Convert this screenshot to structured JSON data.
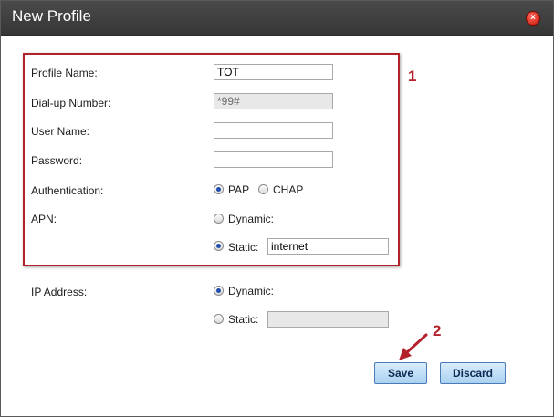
{
  "dialog": {
    "title": "New Profile",
    "close_icon": "close-icon",
    "close_glyph": "×"
  },
  "form": {
    "profile_name": {
      "label": "Profile Name:",
      "value": "TOT"
    },
    "dialup_number": {
      "label": "Dial-up Number:",
      "value": "*99#"
    },
    "user_name": {
      "label": "User Name:",
      "value": ""
    },
    "password": {
      "label": "Password:",
      "value": ""
    },
    "authentication": {
      "label": "Authentication:",
      "options": [
        {
          "label": "PAP",
          "checked": true
        },
        {
          "label": "CHAP",
          "checked": false
        }
      ]
    },
    "apn": {
      "label": "APN:",
      "dynamic_label": "Dynamic:",
      "static_label": "Static:",
      "selected": "static",
      "static_value": "internet"
    },
    "ip_address": {
      "label": "IP Address:",
      "dynamic_label": "Dynamic:",
      "static_label": "Static:",
      "selected": "dynamic",
      "static_value": ""
    }
  },
  "buttons": {
    "save_label": "Save",
    "discard_label": "Discard"
  },
  "annotations": {
    "box_number": "1",
    "arrow_number": "2",
    "color": "#b3212b"
  },
  "colors": {
    "titlebar": "#3f3f3f",
    "button_fill": "#a9d1f0",
    "radio_dot": "#1f4fa8"
  }
}
